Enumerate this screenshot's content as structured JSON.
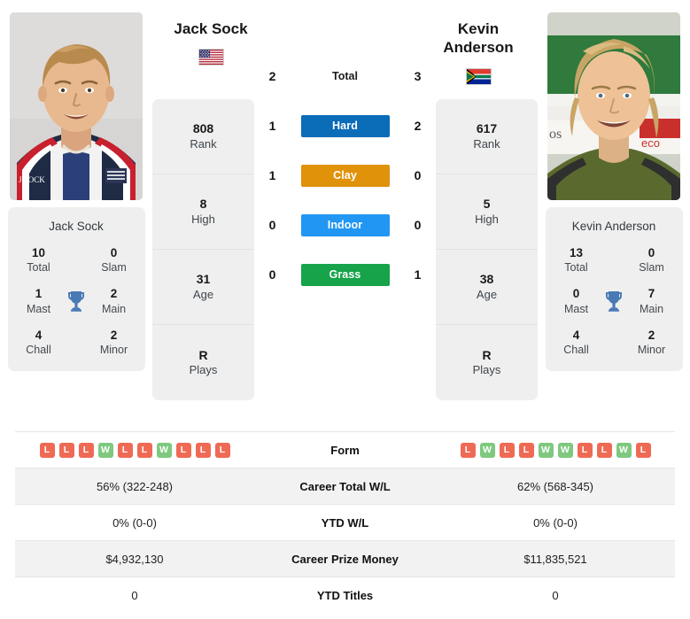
{
  "players": {
    "left": {
      "name": "Jack Sock",
      "card_name": "Jack Sock",
      "country": "USA",
      "flag_icon": "flag-usa-icon",
      "photo_alt": "Jack Sock headshot",
      "rank": {
        "value": "808",
        "label": "Rank"
      },
      "high": {
        "value": "8",
        "label": "High"
      },
      "age": {
        "value": "31",
        "label": "Age"
      },
      "plays": {
        "value": "R",
        "label": "Plays"
      },
      "titles": {
        "total": {
          "value": "10",
          "label": "Total"
        },
        "slam": {
          "value": "0",
          "label": "Slam"
        },
        "mast": {
          "value": "1",
          "label": "Mast"
        },
        "main": {
          "value": "2",
          "label": "Main"
        },
        "chall": {
          "value": "4",
          "label": "Chall"
        },
        "minor": {
          "value": "2",
          "label": "Minor"
        }
      },
      "form": [
        "L",
        "L",
        "L",
        "W",
        "L",
        "L",
        "W",
        "L",
        "L",
        "L"
      ],
      "career_total_wl": "56% (322-248)",
      "ytd_wl": "0% (0-0)",
      "career_prize_money": "$4,932,130",
      "ytd_titles": "0"
    },
    "right": {
      "name": "Kevin Anderson",
      "name_line1": "Kevin",
      "name_line2": "Anderson",
      "card_name": "Kevin Anderson",
      "country": "RSA",
      "flag_icon": "flag-south-africa-icon",
      "photo_alt": "Kevin Anderson headshot",
      "rank": {
        "value": "617",
        "label": "Rank"
      },
      "high": {
        "value": "5",
        "label": "High"
      },
      "age": {
        "value": "38",
        "label": "Age"
      },
      "plays": {
        "value": "R",
        "label": "Plays"
      },
      "titles": {
        "total": {
          "value": "13",
          "label": "Total"
        },
        "slam": {
          "value": "0",
          "label": "Slam"
        },
        "mast": {
          "value": "0",
          "label": "Mast"
        },
        "main": {
          "value": "7",
          "label": "Main"
        },
        "chall": {
          "value": "4",
          "label": "Chall"
        },
        "minor": {
          "value": "2",
          "label": "Minor"
        }
      },
      "form": [
        "L",
        "W",
        "L",
        "L",
        "W",
        "W",
        "L",
        "L",
        "W",
        "L"
      ],
      "career_total_wl": "62% (568-345)",
      "ytd_wl": "0% (0-0)",
      "career_prize_money": "$11,835,521",
      "ytd_titles": "0"
    }
  },
  "head_to_head": {
    "rows": [
      {
        "label": "Total",
        "left": "2",
        "right": "3",
        "style": "plain",
        "color": ""
      },
      {
        "label": "Hard",
        "left": "1",
        "right": "2",
        "style": "badge",
        "color": "#0b6cb8"
      },
      {
        "label": "Clay",
        "left": "1",
        "right": "0",
        "style": "badge",
        "color": "#e0920b"
      },
      {
        "label": "Indoor",
        "left": "0",
        "right": "0",
        "style": "badge",
        "color": "#2196f3"
      },
      {
        "label": "Grass",
        "left": "0",
        "right": "1",
        "style": "badge",
        "color": "#16a34a"
      }
    ]
  },
  "stats_table": {
    "rows": [
      {
        "label": "Form",
        "type": "form",
        "shade": false
      },
      {
        "label": "Career Total W/L",
        "type": "text",
        "shade": true,
        "left": "56% (322-248)",
        "right": "62% (568-345)"
      },
      {
        "label": "YTD W/L",
        "type": "text",
        "shade": false,
        "left": "0% (0-0)",
        "right": "0% (0-0)"
      },
      {
        "label": "Career Prize Money",
        "type": "text",
        "shade": true,
        "left": "$4,932,130",
        "right": "$11,835,521"
      },
      {
        "label": "YTD Titles",
        "type": "text",
        "shade": false,
        "left": "0",
        "right": "0"
      }
    ]
  },
  "colors": {
    "hard": "#0b6cb8",
    "clay": "#e0920b",
    "indoor": "#2196f3",
    "grass": "#16a34a",
    "win_badge": "#7ec97f",
    "loss_badge": "#ef6a55",
    "card_bg": "#efefef",
    "row_shade": "#f2f2f2",
    "trophy": "#4a7ab5"
  }
}
